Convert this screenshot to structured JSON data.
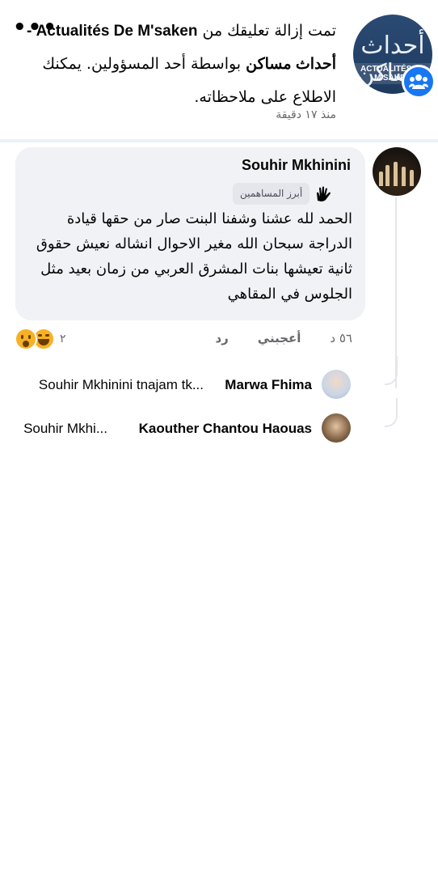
{
  "notification": {
    "avatar_logo_ar": "أحداث مساكن",
    "avatar_logo_lat": "ACTUALITÉS DE M'SAKEN",
    "text_pre": "تمت إزالة تعليقك من ",
    "page_name": "Actualités De M'saken - أحداث مساكن",
    "text_post": " بواسطة أحد المسؤولين. يمكنك الاطلاع على ملاحظاته.",
    "time": "منذ ١٧ دقيقة",
    "more_icon": "more-horizontal-icon"
  },
  "comment": {
    "author": "Souhir Mkhinini",
    "badge_label": "أبرز المساهمين",
    "badge_icon": "top-fan-icon",
    "body": "الحمد لله عشنا وشفنا البنت صار من حقها قيادة الدراجة سبحان الله مغير الاحوال انشاله نعيش حقوق ثانية تعيشها بنات المشرق العربي من زمان بعيد مثل الجلوس في المقاهي",
    "time": "٥٦ د",
    "like_label": "أعجبني",
    "reply_label": "رد",
    "reaction_count": "٢",
    "reaction_icons": [
      "haha-emoji-icon",
      "wow-emoji-icon"
    ]
  },
  "replies": [
    {
      "author": "Marwa Fhima",
      "preview": "Souhir Mkhinini tnajam tk..."
    },
    {
      "author": "Kaouther Chantou Haouas",
      "preview": "Souhir Mkhi..."
    }
  ],
  "colors": {
    "accent": "#1877f2",
    "bubble": "#f0f2f5",
    "secondary_text": "#65676b",
    "divider": "#e9f1fb"
  }
}
